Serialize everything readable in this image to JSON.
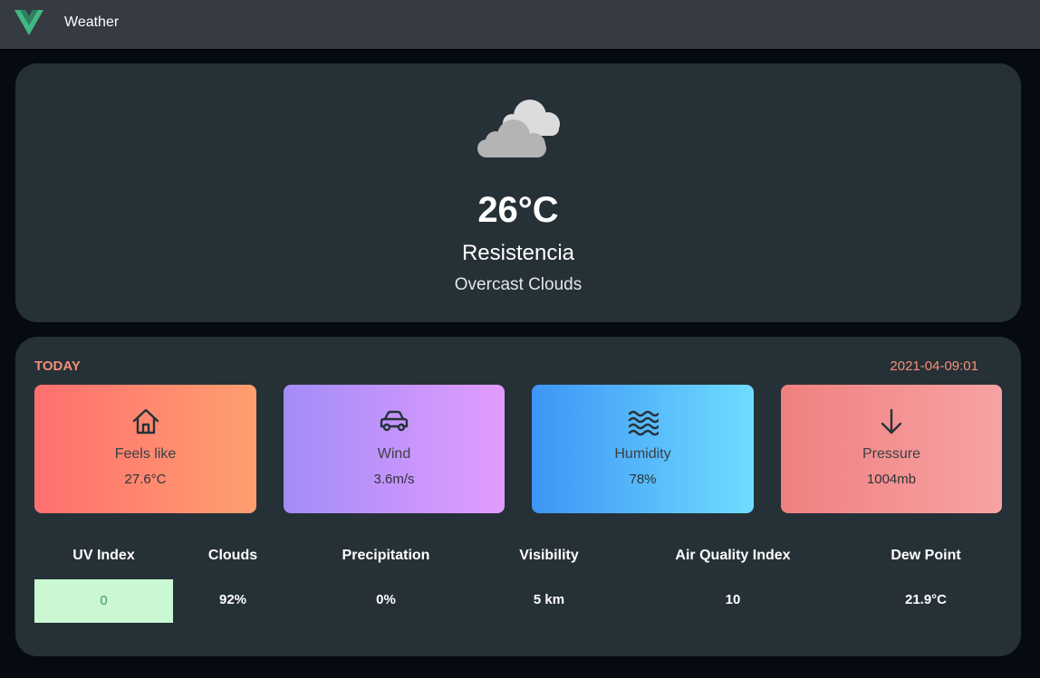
{
  "app": {
    "title": "Weather"
  },
  "current": {
    "temperature": "26°C",
    "city": "Resistencia",
    "description": "Overcast Clouds",
    "icon": "overcast-clouds-icon"
  },
  "today": {
    "label": "TODAY",
    "date": "2021-04-09:01",
    "cards": [
      {
        "label": "Feels like",
        "value": "27.6°C",
        "icon": "home-icon",
        "gradient": [
          "#ff6f6f",
          "#ff9f6f"
        ]
      },
      {
        "label": "Wind",
        "value": "3.6m/s",
        "icon": "car-icon",
        "gradient": [
          "#a38cf7",
          "#e29cff"
        ]
      },
      {
        "label": "Humidity",
        "value": "78%",
        "icon": "waves-icon",
        "gradient": [
          "#3d95f5",
          "#6edcff"
        ]
      },
      {
        "label": "Pressure",
        "value": "1004mb",
        "icon": "arrow-down-icon",
        "gradient": [
          "#f08080",
          "#f7a3a3"
        ]
      }
    ],
    "stats": [
      {
        "label": "UV Index",
        "value": "0",
        "highlight": "#c9f8d2"
      },
      {
        "label": "Clouds",
        "value": "92%"
      },
      {
        "label": "Precipitation",
        "value": "0%"
      },
      {
        "label": "Visibility",
        "value": "5 km"
      },
      {
        "label": "Air Quality Index",
        "value": "10"
      },
      {
        "label": "Dew Point",
        "value": "21.9°C"
      }
    ]
  },
  "colors": {
    "accent": "#f39078",
    "panel": "#263037",
    "topbar": "#363a43",
    "background": "#050b10",
    "logo": "#41b883"
  }
}
